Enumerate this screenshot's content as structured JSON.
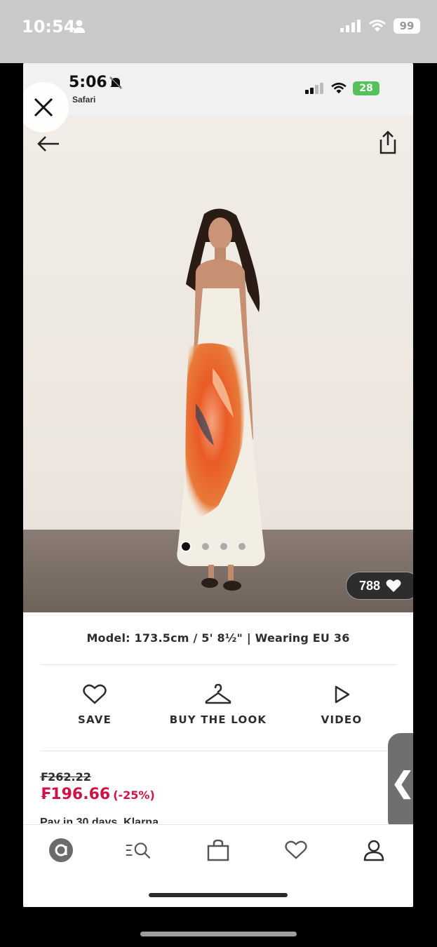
{
  "outer_status": {
    "time": "10:54",
    "battery": "99"
  },
  "inner_status": {
    "time": "5:06",
    "back_app": "Safari",
    "battery": "28"
  },
  "product": {
    "likes": "788",
    "model_info": "Model: 173.5cm / 5' 8½\" | Wearing EU 36",
    "image_dots": 4,
    "active_dot": 1
  },
  "actions": {
    "save": "SAVE",
    "buy_the_look": "BUY THE LOOK",
    "video": "VIDEO"
  },
  "price": {
    "original": "₣262.22",
    "current": "₣196.66",
    "discount": "(-25%)",
    "installments": "Pay in 30 days, Klarna"
  },
  "side_tab": {
    "glyph": "❮"
  },
  "colors": {
    "sale": "#d01345",
    "text": "#2d2d2d"
  },
  "nav": [
    "home-icon",
    "search-icon",
    "bag-icon",
    "saved-icon",
    "account-icon"
  ]
}
